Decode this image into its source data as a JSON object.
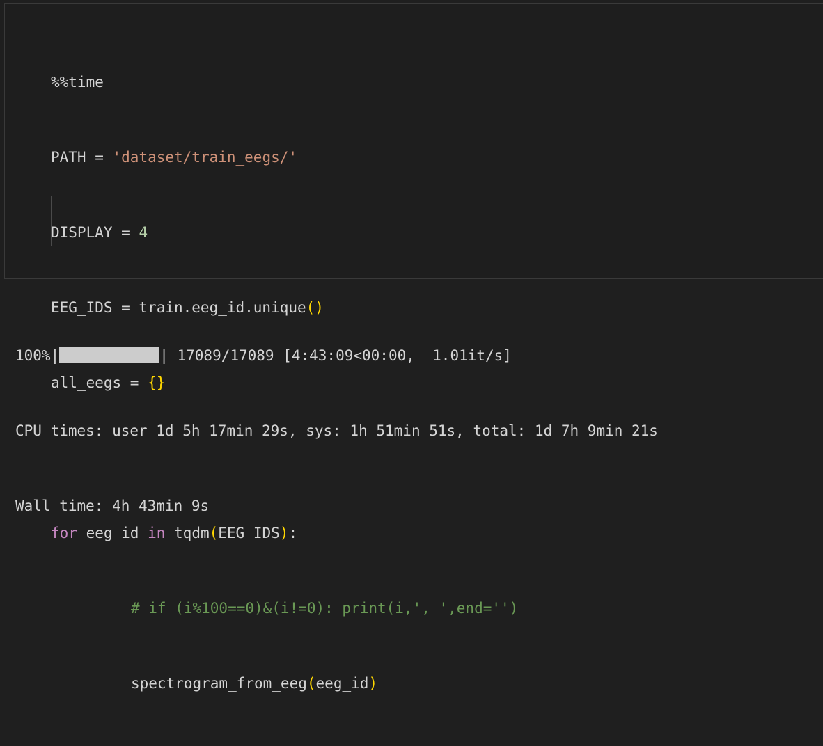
{
  "code": {
    "magic": "%%time",
    "l2_var": "PATH",
    "l2_op": " = ",
    "l2_str": "'dataset/train_eegs/'",
    "l3_var": "DISPLAY",
    "l3_op": " = ",
    "l3_num": "4",
    "l4_text": "EEG_IDS = train.eeg_id.unique",
    "l4_br": "()",
    "l5_text": "all_eegs = ",
    "l5_br": "{}",
    "l7_for": "for",
    "l7_mid": " eeg_id ",
    "l7_in": "in",
    "l7_func": " tqdm",
    "l7_open": "(",
    "l7_arg": "EEG_IDS",
    "l7_close": ")",
    "l7_colon": ":",
    "l8_comment": "# if (i%100==0)&(i!=0): print(i,', ',end='')",
    "l9_func": "spectrogram_from_eeg",
    "l9_open": "(",
    "l9_arg": "eeg_id",
    "l9_close": ")"
  },
  "output": {
    "progress_percent": "100%|",
    "progress_fraction": 1.0,
    "progress_rest": "| 17089/17089 [4:43:09<00:00,  1.01it/s]",
    "cpu_times": "CPU times: user 1d 5h 17min 29s, sys: 1h 51min 51s, total: 1d 7h 9min 21s",
    "wall_time": "Wall time: 4h 43min 9s"
  },
  "colors": {
    "background": "#1f1f1f",
    "keyword": "#c586c0",
    "string": "#ce9178",
    "number": "#b5cea8",
    "bracket": "#ffd700",
    "comment": "#6a9955",
    "progress_bar": "#cccccc"
  }
}
